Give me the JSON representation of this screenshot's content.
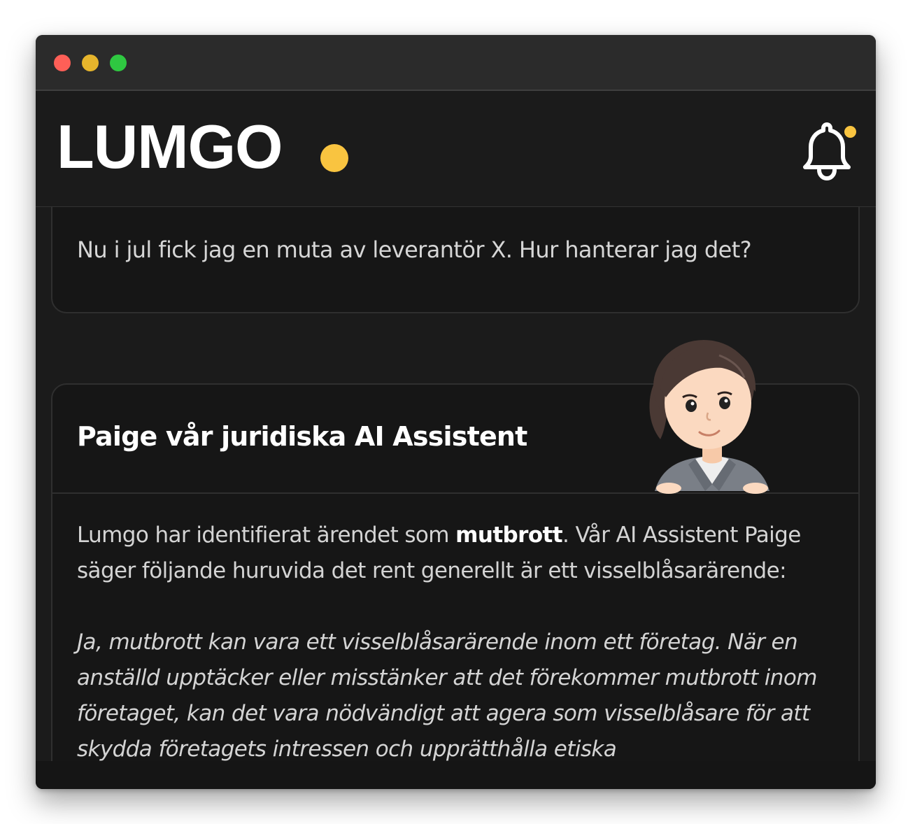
{
  "header": {
    "logo_text": "LUMGO",
    "accent_color": "#f9c440"
  },
  "question": {
    "text": "Nu i jul fick jag en muta av leverantör X. Hur hanterar jag det?"
  },
  "answer": {
    "title": "Paige vår juridiska AI Assistent",
    "intro_before": "Lumgo har identifierat ärendet som ",
    "intro_bold": "mutbrott",
    "intro_after": ". Vår AI Assistent Paige säger följande huruvida det rent generellt är ett visselblåsarärende:",
    "quote": "Ja, mutbrott kan vara ett visselblåsarärende inom ett företag. När en anställd upptäcker eller misstänker att det förekommer mutbrott inom företaget, kan det vara nödvändigt att agera som visselblåsare för att skydda företagets intressen och upprätthålla etiska"
  },
  "icons": {
    "notification": "bell-icon",
    "avatar": "paige-avatar"
  }
}
